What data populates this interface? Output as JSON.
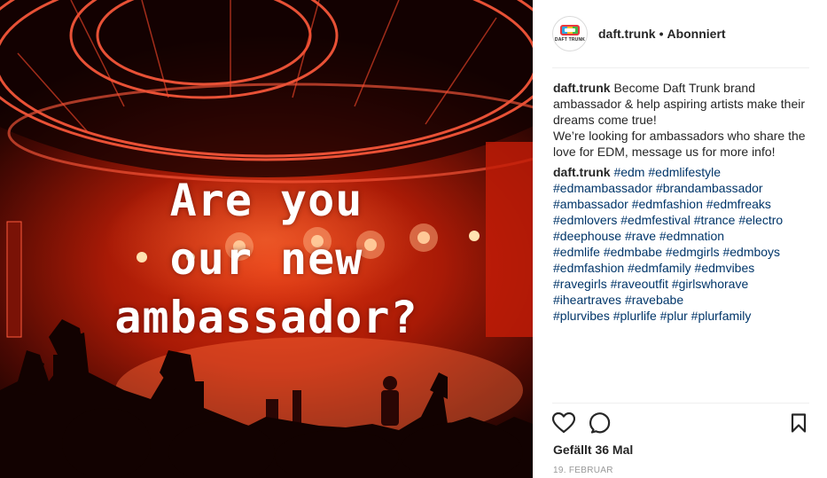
{
  "post": {
    "image_text": [
      "Are you",
      "our new",
      "ambassador?"
    ],
    "author": "daft.trunk",
    "follow_status": "Abonniert",
    "header_separator": "•",
    "avatar_brand": "DAFT TRUNK",
    "caption_line1": "Become Daft Trunk brand ambassador & help aspiring artists make their dreams come true!",
    "caption_line2": "We’re looking for ambassadors who share the love for EDM, message us for more info!",
    "hashtags": [
      [
        "#edm",
        "#edmlifestyle"
      ],
      [
        "#edmambassador",
        "#brandambassador"
      ],
      [
        "#ambassador",
        "#edmfashion",
        "#edmfreaks"
      ],
      [
        "#edmlovers",
        "#edmfestival",
        "#trance",
        "#electro"
      ],
      [
        "#deephouse",
        "#rave",
        "#edmnation"
      ],
      [
        "#edmlife",
        "#edmbabe",
        "#edmgirls",
        "#edmboys"
      ],
      [
        "#edmfashion",
        "#edmfamily",
        "#edmvibes"
      ],
      [
        "#ravegirls",
        "#raveoutfit",
        "#girlswhorave"
      ],
      [
        "#iheartraves",
        "#ravebabe"
      ],
      [
        "#plurvibes",
        "#plurlife",
        "#plur",
        "#plurfamily"
      ]
    ],
    "likes": "Gefällt 36 Mal",
    "date": "19. FEBRUAR"
  },
  "icons": {
    "like": "heart-outline-icon",
    "comment": "comment-bubble-icon",
    "save": "bookmark-icon"
  },
  "colors": {
    "hashtag": "#003569",
    "text": "#262626",
    "muted": "#999999",
    "photo_red": "#d42a0c"
  }
}
